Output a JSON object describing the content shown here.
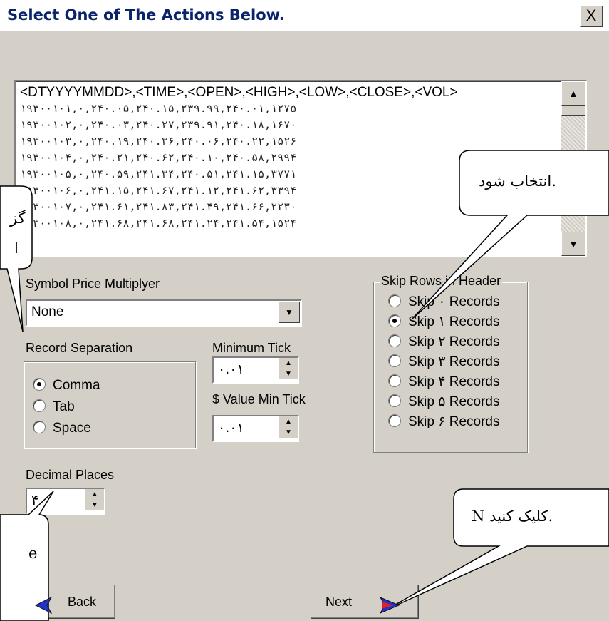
{
  "window": {
    "title": "Select One of The Actions Below.",
    "close_glyph": "X"
  },
  "data_preview": {
    "lines": [
      "<DTYYYYMMDD>,<TIME>,<OPEN>,<HIGH>,<LOW>,<CLOSE>,<VOL>",
      "۱۹۳۰۰۱۰۱,۰,۲۴۰.۰۵,۲۴۰.۱۵,۲۳۹.۹۹,۲۴۰.۰۱,۱۲۷۵",
      "۱۹۳۰۰۱۰۲,۰,۲۴۰.۰۳,۲۴۰.۲۷,۲۳۹.۹۱,۲۴۰.۱۸,۱۶۷۰",
      "۱۹۳۰۰۱۰۳,۰,۲۴۰.۱۹,۲۴۰.۳۶,۲۴۰.۰۶,۲۴۰.۲۲,۱۵۲۶",
      "۱۹۳۰۰۱۰۴,۰,۲۴۰.۲۱,۲۴۰.۶۲,۲۴۰.۱۰,۲۴۰.۵۸,۲۹۹۴",
      "۱۹۳۰۰۱۰۵,۰,۲۴۰.۵۹,۲۴۱.۳۴,۲۴۰.۵۱,۲۴۱.۱۵,۳۷۷۱",
      "۱۹۳۰۰۱۰۶,۰,۲۴۱.۱۵,۲۴۱.۶۷,۲۴۱.۱۲,۲۴۱.۶۲,۳۳۹۴",
      "۱۹۳۰۰۱۰۷,۰,۲۴۱.۶۱,۲۴۱.۸۳,۲۴۱.۴۹,۲۴۱.۶۶,۲۲۳۰",
      "۱۹۳۰۰۱۰۸,۰,۲۴۱.۶۸,۲۴۱.۶۸,۲۴۱.۲۴,۲۴۱.۵۴,۱۵۲۴"
    ]
  },
  "symbol_price_multiplier": {
    "label": "Symbol Price Multiplyer",
    "value": "None"
  },
  "record_separation": {
    "label": "Record Separation",
    "options": [
      "Comma",
      "Tab",
      "Space"
    ],
    "selected": "Comma"
  },
  "minimum_tick": {
    "label": "Minimum Tick",
    "value": "۰.۰۱"
  },
  "value_min_tick": {
    "label": "$ Value Min Tick",
    "value": "۰.۰۱"
  },
  "skip_rows": {
    "label": "Skip Rows in Header",
    "options": [
      "Skip ۰ Records",
      "Skip ۱ Records",
      "Skip ۲ Records",
      "Skip ۳ Records",
      "Skip ۴ Records",
      "Skip ۵ Records",
      "Skip ۶ Records"
    ],
    "selected": "Skip ۱ Records"
  },
  "decimal_places": {
    "label": "Decimal Places",
    "value": "۴"
  },
  "buttons": {
    "back": "Back",
    "next": "Next"
  },
  "callouts": {
    "top_right": "انتخاب شود.",
    "left": "گز",
    "left_line2": "ا",
    "bottom_right": "N کلیک کنید.",
    "bottom_left": "e"
  }
}
